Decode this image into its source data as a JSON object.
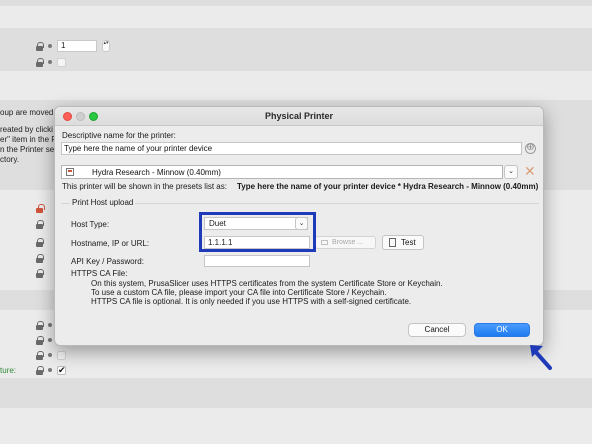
{
  "background": {
    "spin_value": "1",
    "text_lines": [
      "oup are moved t",
      "reated by clicki",
      "er\" item in the P",
      "n the Printer set",
      "ctory."
    ],
    "feature_label": "ture:",
    "stepper_glyph": "▴▾",
    "check_glyph": "✔"
  },
  "dialog": {
    "title": "Physical Printer",
    "descriptive_label": "Descriptive name for the printer:",
    "name_value": "Type here the name of your printer device",
    "add_icon": "⊕",
    "preset_value": "Hydra Research - Minnow (0.40mm)",
    "dropdown_glyph": "⌄",
    "delete_icon": "✕",
    "presets_note_prefix": "This printer will be shown in the presets list as:",
    "presets_note_value": "Type here the name of your printer device * Hydra Research - Minnow (0.40mm)",
    "section_title": "Print Host upload",
    "host_type_label": "Host Type:",
    "host_type_value": "Duet",
    "hostname_label": "Hostname, IP or URL:",
    "hostname_value": "1.1.1.1",
    "browse_label": "Browse ...",
    "test_label": "Test",
    "api_key_label": "API Key / Password:",
    "api_key_value": "",
    "https_label": "HTTPS CA File:",
    "info_lines": [
      "On this system, PrusaSlicer uses HTTPS certificates from the system Certificate Store or Keychain.",
      "To use a custom CA file, please import your CA file into Certificate Store / Keychain.",
      "HTTPS CA file is optional. It is only needed if you use HTTPS with a self-signed certificate."
    ],
    "cancel_label": "Cancel",
    "ok_label": "OK"
  },
  "colors": {
    "highlight_border": "#1f3ab8",
    "ok_button": "#1f7cf0",
    "lock_unlocked": "#d0533d",
    "feature_label": "#2e8b3a"
  }
}
